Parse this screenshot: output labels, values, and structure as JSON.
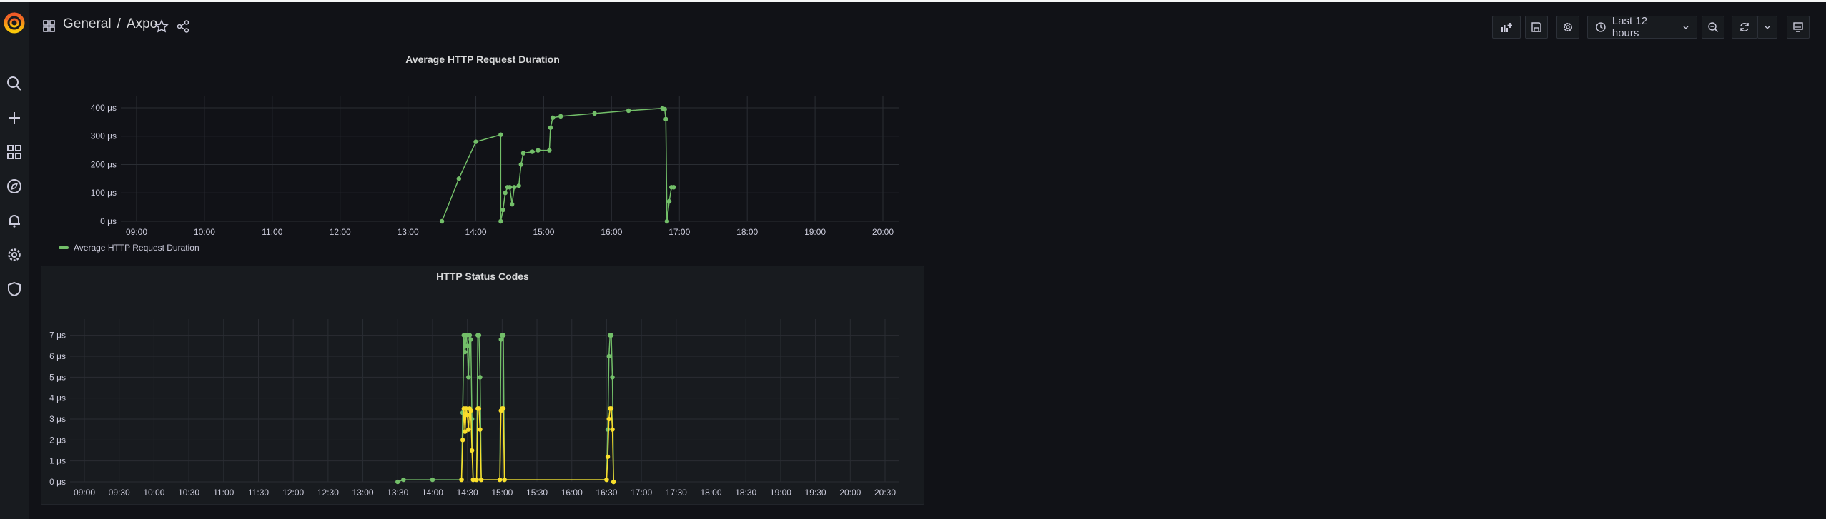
{
  "topbar": {
    "breadcrumb_folder": "General",
    "breadcrumb_separator": "/",
    "breadcrumb_dashboard": "Axpo",
    "time_range_label": "Last 12 hours"
  },
  "sidebar": {
    "items": [
      "search",
      "create",
      "dashboards",
      "explore",
      "alerting",
      "configuration",
      "server-admin"
    ]
  },
  "colors": {
    "series_green": "#73bf69",
    "series_yellow": "#fade2a",
    "background": "#111217"
  },
  "chart_data": [
    {
      "type": "line",
      "title": "Average HTTP Request Duration",
      "x_ticks": [
        "09:00",
        "10:00",
        "11:00",
        "12:00",
        "13:00",
        "14:00",
        "15:00",
        "16:00",
        "17:00",
        "18:00",
        "19:00",
        "20:00"
      ],
      "y_ticks": [
        "0 µs",
        "100 µs",
        "200 µs",
        "300 µs",
        "400 µs"
      ],
      "ylim": [
        0,
        420
      ],
      "grid": true,
      "legend_position": "bottom-left",
      "series": [
        {
          "name": "Average HTTP Request Duration",
          "color": "#73bf69",
          "points": [
            [
              "13:30",
              0
            ],
            [
              "13:45",
              150
            ],
            [
              "14:00",
              280
            ],
            [
              "14:22",
              305
            ],
            [
              "14:22",
              0
            ],
            [
              "14:24",
              40
            ],
            [
              "14:26",
              100
            ],
            [
              "14:28",
              120
            ],
            [
              "14:30",
              120
            ],
            [
              "14:32",
              60
            ],
            [
              "14:34",
              120
            ],
            [
              "14:38",
              125
            ],
            [
              "14:40",
              200
            ],
            [
              "14:42",
              240
            ],
            [
              "14:50",
              245
            ],
            [
              "14:55",
              250
            ],
            [
              "15:05",
              250
            ],
            [
              "15:06",
              330
            ],
            [
              "15:08",
              365
            ],
            [
              "15:15",
              370
            ],
            [
              "15:45",
              380
            ],
            [
              "16:15",
              390
            ],
            [
              "16:45",
              398
            ],
            [
              "16:47",
              395
            ],
            [
              "16:48",
              360
            ],
            [
              "16:49",
              0
            ],
            [
              "16:51",
              70
            ],
            [
              "16:53",
              120
            ],
            [
              "16:55",
              120
            ]
          ]
        }
      ]
    },
    {
      "type": "line",
      "title": "HTTP Status Codes",
      "x_ticks": [
        "09:00",
        "09:30",
        "10:00",
        "10:30",
        "11:00",
        "11:30",
        "12:00",
        "12:30",
        "13:00",
        "13:30",
        "14:00",
        "14:30",
        "15:00",
        "15:30",
        "16:00",
        "16:30",
        "17:00",
        "17:30",
        "18:00",
        "18:30",
        "19:00",
        "19:30",
        "20:00",
        "20:30"
      ],
      "y_ticks": [
        "0 µs",
        "1 µs",
        "2 µs",
        "3 µs",
        "4 µs",
        "5 µs",
        "6 µs",
        "7 µs"
      ],
      "ylim": [
        0,
        7.5
      ],
      "grid": true,
      "series": [
        {
          "color": "#73bf69",
          "points": [
            [
              "13:30",
              0
            ],
            [
              "13:35",
              0.1
            ],
            [
              "14:00",
              0.1
            ],
            [
              "14:25",
              0.1
            ],
            [
              "14:26",
              3.3
            ],
            [
              "14:27",
              7
            ],
            [
              "14:28",
              6.2
            ],
            [
              "14:29",
              7
            ],
            [
              "14:30",
              6.5
            ],
            [
              "14:31",
              5.0
            ],
            [
              "14:32",
              7
            ],
            [
              "14:33",
              6.8
            ],
            [
              "14:34",
              3
            ],
            [
              "14:35",
              0.1
            ],
            [
              "14:38",
              0.1
            ],
            [
              "14:39",
              7
            ],
            [
              "14:40",
              7
            ],
            [
              "14:41",
              5
            ],
            [
              "14:42",
              0.1
            ],
            [
              "14:58",
              0.1
            ],
            [
              "14:59",
              6.8
            ],
            [
              "15:00",
              7
            ],
            [
              "15:01",
              7
            ],
            [
              "15:02",
              0.1
            ],
            [
              "16:30",
              0.1
            ],
            [
              "16:31",
              2.5
            ],
            [
              "16:32",
              6
            ],
            [
              "16:33",
              7
            ],
            [
              "16:34",
              7
            ],
            [
              "16:35",
              5
            ],
            [
              "16:36",
              0
            ]
          ]
        },
        {
          "color": "#fade2a",
          "points": [
            [
              "14:25",
              0.1
            ],
            [
              "14:26",
              2
            ],
            [
              "14:27",
              3.5
            ],
            [
              "14:28",
              2.4
            ],
            [
              "14:29",
              3.5
            ],
            [
              "14:30",
              3.2
            ],
            [
              "14:31",
              2.5
            ],
            [
              "14:32",
              3.5
            ],
            [
              "14:33",
              3.4
            ],
            [
              "14:34",
              1.5
            ],
            [
              "14:35",
              0.1
            ],
            [
              "14:38",
              0.1
            ],
            [
              "14:39",
              3.5
            ],
            [
              "14:40",
              3.5
            ],
            [
              "14:41",
              2.5
            ],
            [
              "14:42",
              0.1
            ],
            [
              "14:58",
              0.1
            ],
            [
              "14:59",
              3.4
            ],
            [
              "15:00",
              3.5
            ],
            [
              "15:01",
              3.5
            ],
            [
              "15:02",
              0.1
            ],
            [
              "16:30",
              0.1
            ],
            [
              "16:31",
              1.2
            ],
            [
              "16:32",
              3
            ],
            [
              "16:33",
              3.5
            ],
            [
              "16:34",
              3.5
            ],
            [
              "16:35",
              2.5
            ],
            [
              "16:36",
              0
            ]
          ]
        }
      ]
    }
  ]
}
